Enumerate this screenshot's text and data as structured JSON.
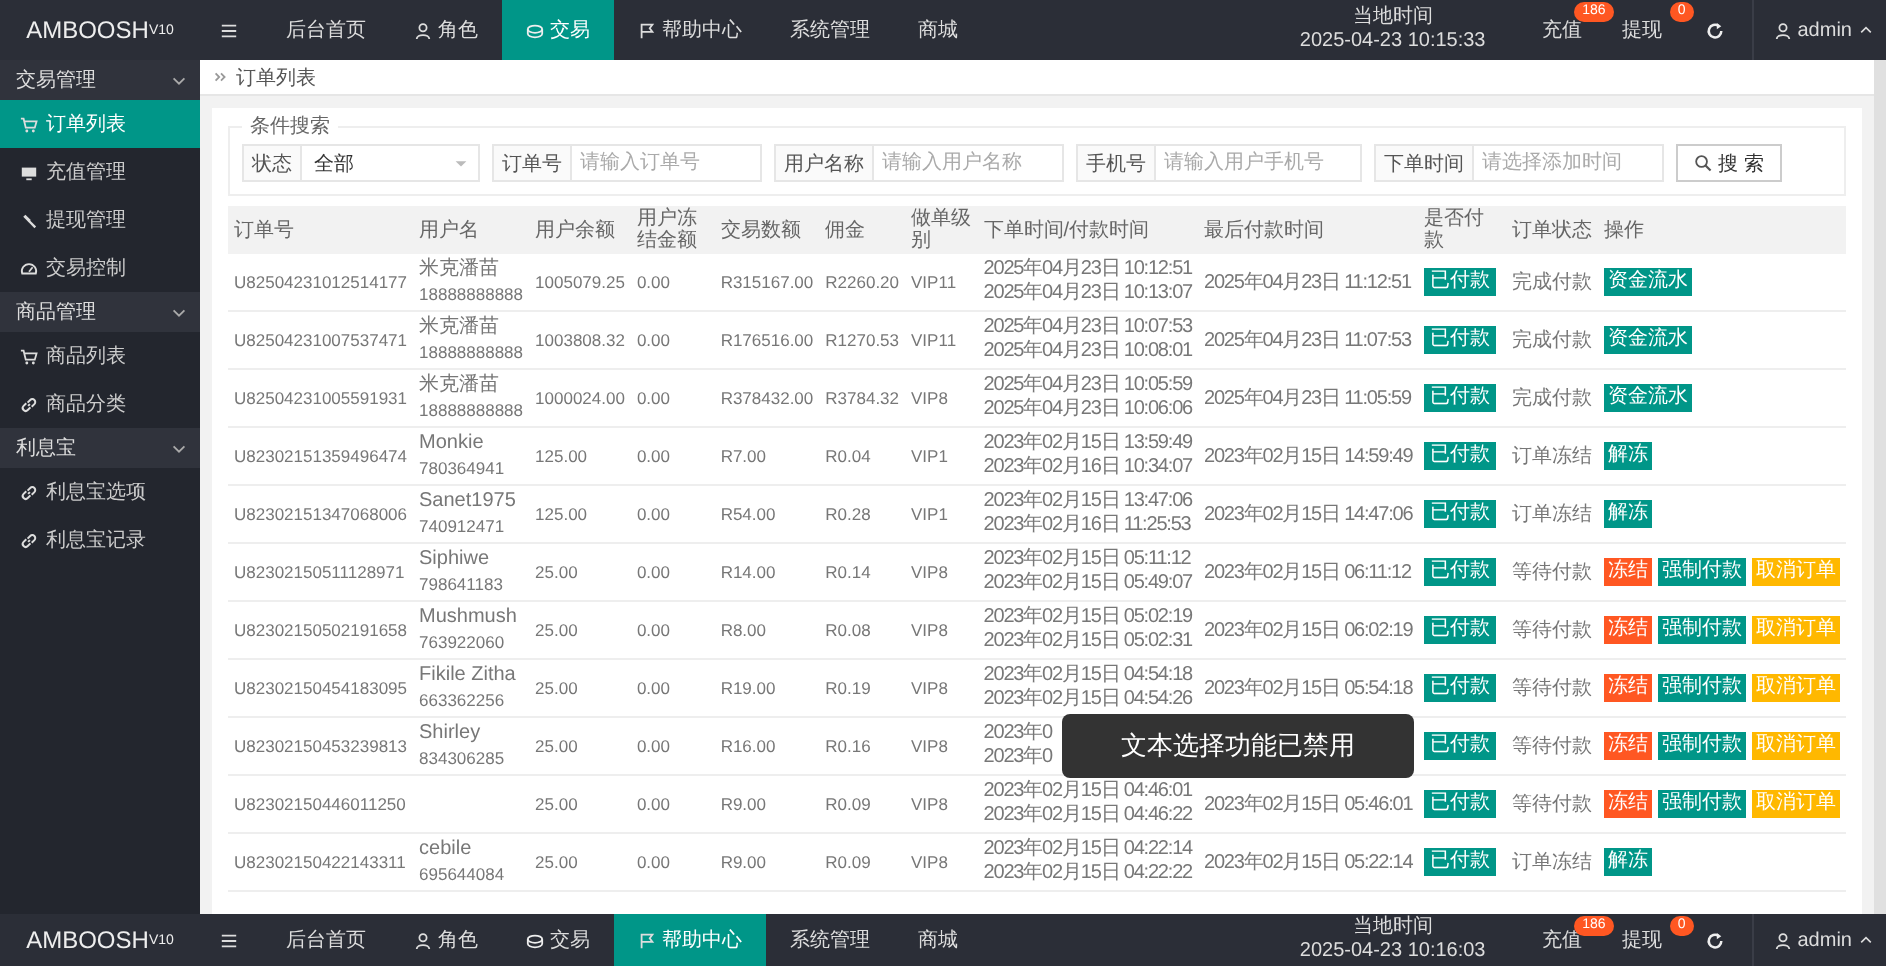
{
  "bars": [
    {
      "logo": "AMBOOSH$^{V10}$",
      "nav": [
        {
          "label": "后台首页",
          "selected": false
        },
        {
          "label": "角色",
          "selected": false
        },
        {
          "label": "交易",
          "selected": true
        },
        {
          "label": "帮助中心",
          "selected": false
        },
        {
          "label": "系统管理",
          "selected": false
        },
        {
          "label": "商城",
          "selected": false
        }
      ],
      "clock_label": "当地时间",
      "clock": "2025-04-23 10:15:33",
      "recharge": {
        "label": "充值",
        "badge": "186"
      },
      "withdraw": {
        "label": "提现",
        "badge": "0"
      },
      "user": "admin"
    },
    {
      "logo": "AMBOOSH$^{V10}$",
      "nav": [
        {
          "label": "后台首页",
          "selected": false
        },
        {
          "label": "角色",
          "selected": false
        },
        {
          "label": "交易",
          "selected": false
        },
        {
          "label": "帮助中心",
          "selected": true
        },
        {
          "label": "系统管理",
          "selected": false
        },
        {
          "label": "商城",
          "selected": false
        }
      ],
      "clock_label": "当地时间",
      "clock": "2025-04-23 10:16:03",
      "recharge": {
        "label": "充值",
        "badge": "186"
      },
      "withdraw": {
        "label": "提现",
        "badge": "0"
      },
      "user": "admin"
    }
  ],
  "sidebar": [
    {
      "label": "交易管理",
      "expanded": true,
      "items": [
        {
          "label": "订单列表",
          "selected": true
        },
        {
          "label": "充值管理",
          "selected": false
        },
        {
          "label": "提现管理",
          "selected": false
        },
        {
          "label": "交易控制",
          "selected": false
        }
      ]
    },
    {
      "label": "商品管理",
      "expanded": true,
      "items": [
        {
          "label": "商品列表",
          "selected": false
        },
        {
          "label": "商品分类",
          "selected": false
        }
      ]
    },
    {
      "label": "利息宝",
      "expanded": true,
      "items": [
        {
          "label": "利息宝选项",
          "selected": false
        },
        {
          "label": "利息宝记录",
          "selected": false
        }
      ]
    }
  ],
  "breadcrumb": "订单列表",
  "search": {
    "legend": "条件搜索",
    "status_label": "状态",
    "status_value": "全部",
    "fields": [
      {
        "label": "订单号",
        "placeholder": "请输入订单号"
      },
      {
        "label": "用户名称",
        "placeholder": "请输入用户名称"
      },
      {
        "label": "手机号",
        "placeholder": "请输入用户手机号"
      },
      {
        "label": "下单时间",
        "placeholder": "请选择添加时间"
      }
    ],
    "button": "搜 索"
  },
  "table": {
    "columns": [
      "订单号",
      "用户名",
      "用户余额",
      "用户冻结金额",
      "交易数额",
      "佣金",
      "做单级别",
      "下单时间/付款时间",
      "最后付款时间",
      "是否付款",
      "订单状态",
      "操作"
    ],
    "rows": [
      {
        "order": "U82504231012514177",
        "user": "米克潘苗",
        "phone": "18888888888",
        "balance": "1005079.25",
        "frozen": "0.00",
        "amount": "R315167.00",
        "commission": "R2260.20",
        "level": "VIP11",
        "time1": "2025年04月23日 10:12:51",
        "time2": "2025年04月23日 10:13:07",
        "deadline": "2025年04月23日 11:12:51",
        "paid": true,
        "paid_label": "已付款",
        "status": "完成付款",
        "actions": [
          {
            "label": "资金流水",
            "kind": "primary"
          }
        ]
      },
      {
        "order": "U82504231007537471",
        "user": "米克潘苗",
        "phone": "18888888888",
        "balance": "1003808.32",
        "frozen": "0.00",
        "amount": "R176516.00",
        "commission": "R1270.53",
        "level": "VIP11",
        "time1": "2025年04月23日 10:07:53",
        "time2": "2025年04月23日 10:08:01",
        "deadline": "2025年04月23日 11:07:53",
        "paid": true,
        "paid_label": "已付款",
        "status": "完成付款",
        "actions": [
          {
            "label": "资金流水",
            "kind": "primary"
          }
        ]
      },
      {
        "order": "U82504231005591931",
        "user": "米克潘苗",
        "phone": "18888888888",
        "balance": "1000024.00",
        "frozen": "0.00",
        "amount": "R378432.00",
        "commission": "R3784.32",
        "level": "VIP8",
        "time1": "2025年04月23日 10:05:59",
        "time2": "2025年04月23日 10:06:06",
        "deadline": "2025年04月23日 11:05:59",
        "paid": true,
        "paid_label": "已付款",
        "status": "完成付款",
        "actions": [
          {
            "label": "资金流水",
            "kind": "primary"
          }
        ]
      },
      {
        "order": "U82302151359496474",
        "user": "Monkie",
        "phone": "780364941",
        "balance": "125.00",
        "frozen": "0.00",
        "amount": "R7.00",
        "commission": "R0.04",
        "level": "VIP1",
        "time1": "2023年02月15日 13:59:49",
        "time2": "2023年02月16日 10:34:07",
        "deadline": "2023年02月15日 14:59:49",
        "paid": true,
        "paid_label": "已付款",
        "status": "订单冻结",
        "actions": [
          {
            "label": "解冻",
            "kind": "primary"
          }
        ]
      },
      {
        "order": "U82302151347068006",
        "user": "Sanet1975",
        "phone": "740912471",
        "balance": "125.00",
        "frozen": "0.00",
        "amount": "R54.00",
        "commission": "R0.28",
        "level": "VIP1",
        "time1": "2023年02月15日 13:47:06",
        "time2": "2023年02月16日 11:25:53",
        "deadline": "2023年02月15日 14:47:06",
        "paid": true,
        "paid_label": "已付款",
        "status": "订单冻结",
        "actions": [
          {
            "label": "解冻",
            "kind": "primary"
          }
        ]
      },
      {
        "order": "U82302150511128971",
        "user": "Siphiwe",
        "phone": "798641183",
        "balance": "25.00",
        "frozen": "0.00",
        "amount": "R14.00",
        "commission": "R0.14",
        "level": "VIP8",
        "time1": "2023年02月15日 05:11:12",
        "time2": "2023年02月15日 05:49:07",
        "deadline": "2023年02月15日 06:11:12",
        "paid": true,
        "paid_label": "已付款",
        "status": "等待付款",
        "actions": [
          {
            "label": "冻结",
            "kind": "danger"
          },
          {
            "label": "强制付款",
            "kind": "primary"
          },
          {
            "label": "取消订单",
            "kind": "warning"
          }
        ]
      },
      {
        "order": "U82302150502191658",
        "user": "Mushmush",
        "phone": "763922060",
        "balance": "25.00",
        "frozen": "0.00",
        "amount": "R8.00",
        "commission": "R0.08",
        "level": "VIP8",
        "time1": "2023年02月15日 05:02:19",
        "time2": "2023年02月15日 05:02:31",
        "deadline": "2023年02月15日 06:02:19",
        "paid": true,
        "paid_label": "已付款",
        "status": "等待付款",
        "actions": [
          {
            "label": "冻结",
            "kind": "danger"
          },
          {
            "label": "强制付款",
            "kind": "primary"
          },
          {
            "label": "取消订单",
            "kind": "warning"
          }
        ]
      },
      {
        "order": "U82302150454183095",
        "user": "Fikile Zitha",
        "phone": "663362256",
        "balance": "25.00",
        "frozen": "0.00",
        "amount": "R19.00",
        "commission": "R0.19",
        "level": "VIP8",
        "time1": "2023年02月15日 04:54:18",
        "time2": "2023年02月15日 04:54:26",
        "deadline": "2023年02月15日 05:54:18",
        "paid": true,
        "paid_label": "已付款",
        "status": "等待付款",
        "actions": [
          {
            "label": "冻结",
            "kind": "danger"
          },
          {
            "label": "强制付款",
            "kind": "primary"
          },
          {
            "label": "取消订单",
            "kind": "warning"
          }
        ]
      },
      {
        "order": "U82302150453239813",
        "user": "Shirley",
        "phone": "834306285",
        "balance": "25.00",
        "frozen": "0.00",
        "amount": "R16.00",
        "commission": "R0.16",
        "level": "VIP8",
        "time1": "2023年0",
        "time2": "2023年0",
        "paid": true,
        "paid_label": "已付款",
        "status": "等待付款",
        "actions": [
          {
            "label": "冻结",
            "kind": "danger"
          },
          {
            "label": "强制付款",
            "kind": "primary"
          },
          {
            "label": "取消订单",
            "kind": "warning"
          }
        ],
        "toast": "文本选择功能已禁用"
      },
      {
        "order": "U82302150446011250",
        "balance": "25.00",
        "frozen": "0.00",
        "amount": "R9.00",
        "commission": "R0.09",
        "level": "VIP8",
        "time1": "2023年02月15日 04:46:01",
        "time2": "2023年02月15日 04:46:22",
        "deadline": "2023年02月15日 05:46:01",
        "paid": true,
        "paid_label": "已付款",
        "status": "等待付款",
        "actions": [
          {
            "label": "冻结",
            "kind": "danger"
          },
          {
            "label": "强制付款",
            "kind": "primary"
          },
          {
            "label": "取消订单",
            "kind": "warning"
          }
        ]
      },
      {
        "order": "U82302150422143311",
        "user": "cebile",
        "phone": "695644084",
        "balance": "25.00",
        "frozen": "0.00",
        "amount": "R9.00",
        "commission": "R0.09",
        "level": "VIP8",
        "time1": "2023年02月15日 04:22:14",
        "time2": "2023年02月15日 04:22:22",
        "deadline": "2023年02月15日 05:22:14",
        "paid": true,
        "paid_label": "已付款",
        "status": "订单冻结",
        "actions": [
          {
            "label": "解冻",
            "kind": "primary"
          }
        ]
      }
    ]
  }
}
